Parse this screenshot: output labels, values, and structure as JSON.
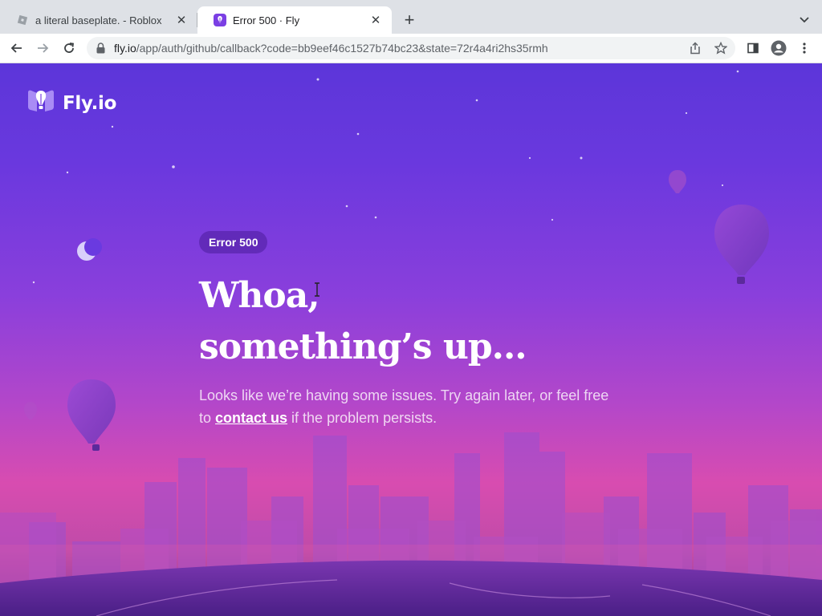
{
  "browser": {
    "tabs": [
      {
        "title": "a literal baseplate. - Roblox",
        "active": false,
        "favicon": "roblox-favicon"
      },
      {
        "title": "Error 500 · Fly",
        "active": true,
        "favicon": "fly-favicon"
      }
    ],
    "url_host": "fly.io",
    "url_path": "/app/auth/github/callback?code=bb9eef46c1527b74bc23&state=72r4a4ri2hs35rmh"
  },
  "page": {
    "logo_text": "Fly.io",
    "badge": "Error 500",
    "headline_line1": "Whoa,",
    "headline_line2": "something’s up...",
    "desc_before": "Looks like we’re having some issues. Try again later, or feel free to ",
    "desc_link": "contact us",
    "desc_after": " if the problem persists."
  },
  "colors": {
    "accent": "#7b3fe4",
    "background_top": "#5c36d9",
    "background_bottom": "#d84cb0"
  }
}
